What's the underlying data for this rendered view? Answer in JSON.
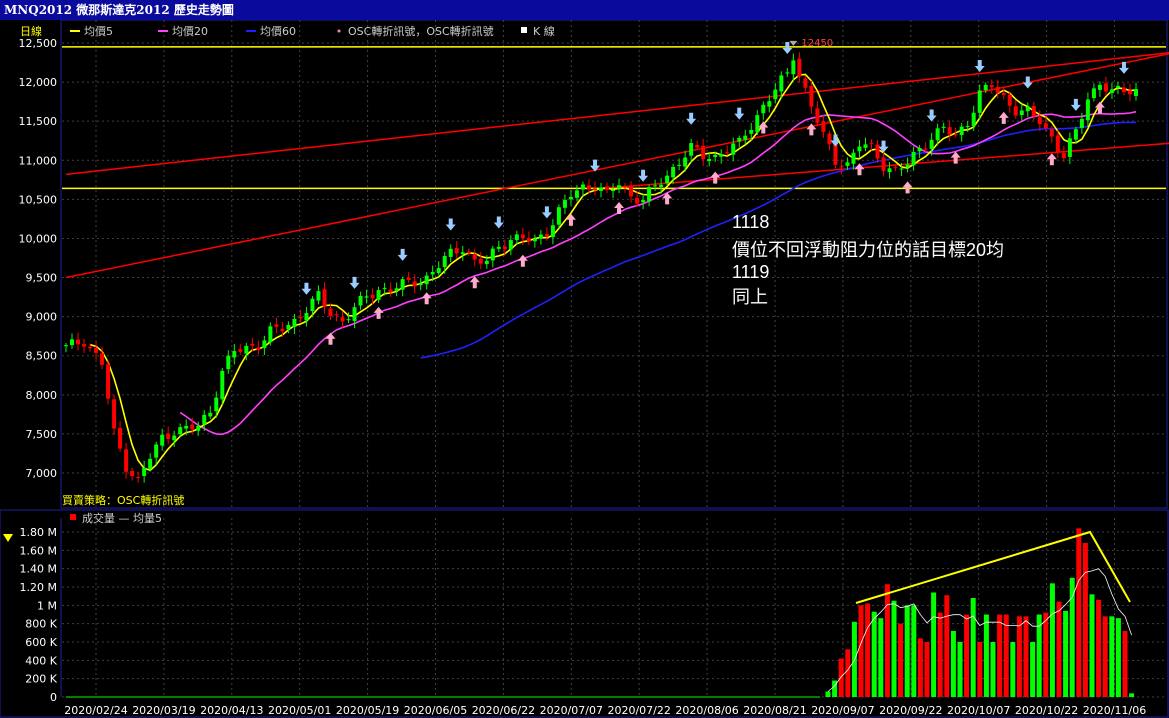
{
  "window": {
    "title": "MNQ2012 微那斯達克2012  歷史走勢圖"
  },
  "legend": {
    "period": "日線",
    "items": [
      {
        "label": "均價5",
        "color": "#ffff00",
        "glyph": "line"
      },
      {
        "label": "均價20",
        "color": "#ff40ff",
        "glyph": "line"
      },
      {
        "label": "均價60",
        "color": "#2020ff",
        "glyph": "line"
      },
      {
        "label": "OSC轉折訊號，OSC轉折訊號",
        "color": "#ff80c0",
        "glyph": "dot"
      },
      {
        "label": "K 線",
        "color": "#ffffff",
        "glyph": "square"
      }
    ]
  },
  "strategy_label": "買賣策略：OSC轉折訊號",
  "volume_legend": {
    "label": "成交量 — 均量5",
    "color": "#ff0000"
  },
  "collapse_icon": "triangle-down-icon",
  "colors": {
    "up": "#00ff00",
    "down": "#ff0000",
    "grid": "#404040",
    "ma5": "#ffff00",
    "ma20": "#ff40ff",
    "ma60": "#2020ff",
    "arrow_down": "#99ccff",
    "arrow_up": "#ffaacc",
    "channel": "#ff0000",
    "hline": "#ffff00",
    "axis_text": "#ffffff",
    "frame": "#2020a0"
  },
  "annotation": {
    "lines": [
      "1118",
      "價位不回浮動阻力位的話目標20均",
      "1119",
      "同上"
    ]
  },
  "chart_data": {
    "type": "candlestick",
    "x_ticks": [
      "2020/02/24",
      "2020/03/19",
      "2020/04/13",
      "2020/05/01",
      "2020/05/19",
      "2020/06/05",
      "2020/06/22",
      "2020/07/07",
      "2020/07/22",
      "2020/08/06",
      "2020/08/21",
      "2020/09/07",
      "2020/09/22",
      "2020/10/07",
      "2020/10/22",
      "2020/11/06"
    ],
    "price_axis": {
      "ticks": [
        7000,
        7500,
        8000,
        8500,
        9000,
        9500,
        10000,
        10500,
        11000,
        11500,
        12000,
        12500
      ],
      "tick_labels": [
        "7,000",
        "7,500",
        "8,000",
        "8,500",
        "9,000",
        "9,500",
        "10,000",
        "10,500",
        "11,000",
        "11,500",
        "12,000",
        "12,500"
      ],
      "ylim": [
        6700,
        12560
      ]
    },
    "volume_axis": {
      "ticks": [
        0,
        200000,
        400000,
        600000,
        800000,
        1000000,
        1200000,
        1400000,
        1600000,
        1800000
      ],
      "tick_labels": [
        "0",
        "200 K",
        "400 K",
        "600 K",
        "800 K",
        "1 M",
        "1.20 M",
        "1.40 M",
        "1.60 M",
        "1.80 M"
      ],
      "ylim": [
        0,
        1850000
      ]
    },
    "high_marker": {
      "label": "12450",
      "value": 12450
    },
    "horizontal_levels": [
      12450,
      10640
    ],
    "channel_lines": [
      {
        "from": [
          0,
          9500
        ],
        "to": [
          179,
          12370
        ]
      },
      {
        "from": [
          0,
          10820
        ],
        "to": [
          179,
          12380
        ]
      },
      {
        "from": [
          89,
          10640
        ],
        "to": [
          179,
          11220
        ]
      }
    ],
    "n_bars": 179,
    "anchors": [
      [
        0,
        8600
      ],
      [
        3,
        8700
      ],
      [
        6,
        8400
      ],
      [
        8,
        7500
      ],
      [
        10,
        7100
      ],
      [
        12,
        6900
      ],
      [
        14,
        7200
      ],
      [
        16,
        7450
      ],
      [
        18,
        7550
      ],
      [
        20,
        7550
      ],
      [
        22,
        7600
      ],
      [
        24,
        7800
      ],
      [
        26,
        8300
      ],
      [
        28,
        8550
      ],
      [
        30,
        8600
      ],
      [
        32,
        8650
      ],
      [
        34,
        8800
      ],
      [
        36,
        8850
      ],
      [
        38,
        8950
      ],
      [
        40,
        9100
      ],
      [
        42,
        9250
      ],
      [
        44,
        9050
      ],
      [
        46,
        8950
      ],
      [
        48,
        9100
      ],
      [
        50,
        9250
      ],
      [
        52,
        9350
      ],
      [
        54,
        9350
      ],
      [
        56,
        9400
      ],
      [
        58,
        9450
      ],
      [
        60,
        9500
      ],
      [
        62,
        9650
      ],
      [
        64,
        9800
      ],
      [
        66,
        9900
      ],
      [
        68,
        9700
      ],
      [
        70,
        9700
      ],
      [
        72,
        9900
      ],
      [
        74,
        10000
      ],
      [
        76,
        10000
      ],
      [
        78,
        9950
      ],
      [
        80,
        10100
      ],
      [
        82,
        10350
      ],
      [
        84,
        10550
      ],
      [
        86,
        10650
      ],
      [
        88,
        10700
      ],
      [
        90,
        10550
      ],
      [
        92,
        10700
      ],
      [
        94,
        10550
      ],
      [
        96,
        10500
      ],
      [
        98,
        10650
      ],
      [
        100,
        10800
      ],
      [
        102,
        11000
      ],
      [
        104,
        11150
      ],
      [
        106,
        11050
      ],
      [
        108,
        11050
      ],
      [
        110,
        11150
      ],
      [
        112,
        11200
      ],
      [
        114,
        11450
      ],
      [
        116,
        11700
      ],
      [
        118,
        11900
      ],
      [
        120,
        12100
      ],
      [
        121,
        12350
      ],
      [
        122,
        12100
      ],
      [
        124,
        11700
      ],
      [
        126,
        11300
      ],
      [
        128,
        11000
      ],
      [
        130,
        10950
      ],
      [
        132,
        11200
      ],
      [
        134,
        11150
      ],
      [
        136,
        10950
      ],
      [
        138,
        10850
      ],
      [
        140,
        10950
      ],
      [
        142,
        11150
      ],
      [
        144,
        11300
      ],
      [
        146,
        11400
      ],
      [
        148,
        11300
      ],
      [
        150,
        11500
      ],
      [
        152,
        11850
      ],
      [
        154,
        11950
      ],
      [
        156,
        11800
      ],
      [
        158,
        11650
      ],
      [
        160,
        11600
      ],
      [
        162,
        11500
      ],
      [
        164,
        11300
      ],
      [
        166,
        11050
      ],
      [
        168,
        11350
      ],
      [
        170,
        11800
      ],
      [
        172,
        12000
      ],
      [
        174,
        11850
      ],
      [
        176,
        11900
      ],
      [
        178,
        11900
      ]
    ],
    "volume_series": {
      "start_bar": 126,
      "values": [
        60000,
        180000,
        420000,
        520000,
        820000,
        1000000,
        1020000,
        930000,
        860000,
        1230000,
        1050000,
        800000,
        1000000,
        1000000,
        640000,
        600000,
        1140000,
        920000,
        1110000,
        720000,
        600000,
        900000,
        1080000,
        600000,
        900000,
        600000,
        900000,
        900000,
        600000,
        880000,
        880000,
        600000,
        900000,
        920000,
        1240000,
        1040000,
        940000,
        1300000,
        1840000,
        1680000,
        1120000,
        1060000,
        880000,
        880000,
        860000,
        720000,
        40000
      ]
    },
    "ma60_start_bar": 59,
    "ma20_start_bar": 19
  }
}
